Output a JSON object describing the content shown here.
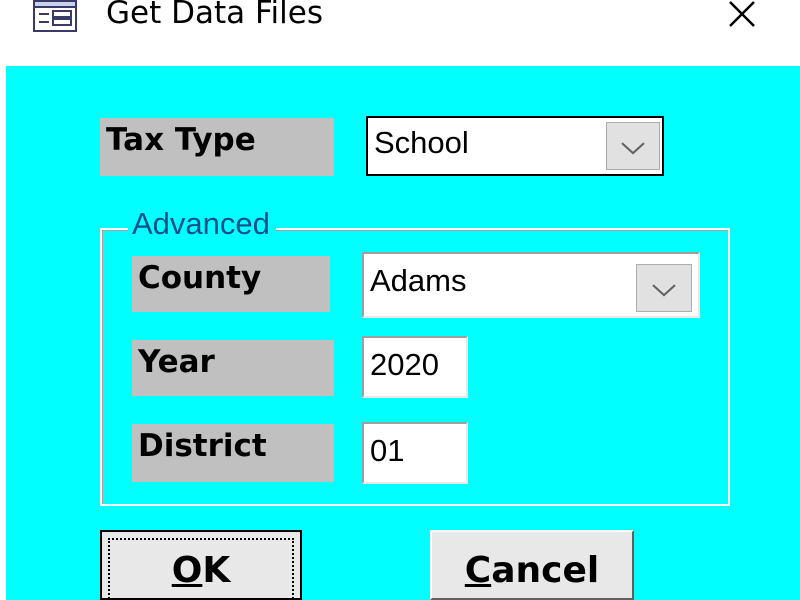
{
  "window": {
    "title": "Get Data Files",
    "close_glyph": "✕",
    "icon": "form-window-icon"
  },
  "tax_type": {
    "label": "Tax Type",
    "value": "School"
  },
  "advanced": {
    "legend": "Advanced",
    "county": {
      "label": "County",
      "value": "Adams"
    },
    "year": {
      "label": "Year",
      "value": "2020"
    },
    "district": {
      "label": "District",
      "value": "01"
    }
  },
  "buttons": {
    "ok_mnemonic": "O",
    "ok_rest": "K",
    "cancel_mnemonic": "C",
    "cancel_rest": "ancel"
  },
  "colors": {
    "client_background": "#00ffff",
    "label_background": "#c0c0c0",
    "legend_text": "#0b4f8a"
  }
}
